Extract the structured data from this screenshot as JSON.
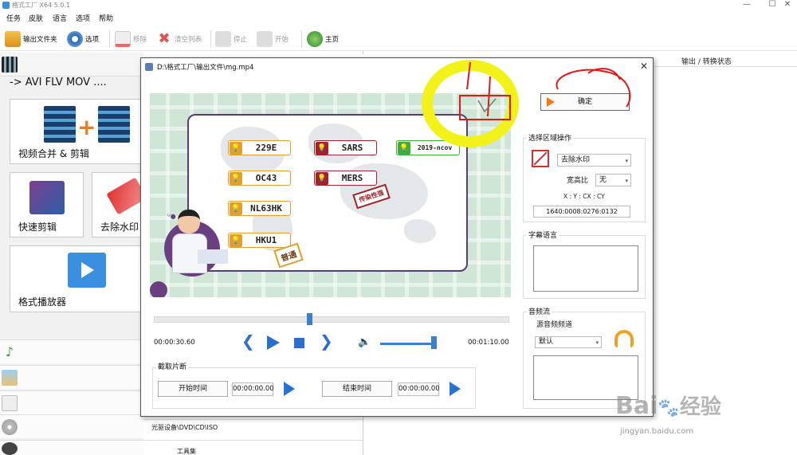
{
  "window": {
    "title": "格式工厂 X64 5.0.1",
    "min": "—",
    "max": "☐",
    "close": "✕"
  },
  "menu": [
    "任务",
    "皮肤",
    "语言",
    "选项",
    "帮助"
  ],
  "toolbar": {
    "output_folder": "输出文件夹",
    "options": "选项",
    "remove": "移除",
    "clear_list": "清空列表",
    "stop": "停止",
    "start": "开始",
    "home": "主页"
  },
  "left": {
    "formats_line": "-> AVI FLV MOV ....",
    "tiles": [
      {
        "label": "视频合并 & 剪辑",
        "icon": "film-merge-icon"
      },
      {
        "label": "快速剪辑",
        "icon": "quick-cut-icon"
      },
      {
        "label": "去除水印",
        "icon": "watermark-eraser-icon"
      },
      {
        "label": "格式播放器",
        "icon": "media-player-icon"
      }
    ],
    "rows": [
      "光驱设备\\DVD\\CD\\ISO",
      "工具集"
    ]
  },
  "list_header": {
    "output_status": "输出 / 转换状态"
  },
  "dialog": {
    "title": "D:\\格式工厂\\输出文件\\mg.mp4",
    "close": "✕",
    "confirm": "确定",
    "video": {
      "viruses": [
        "229E",
        "SARS",
        "2019-ncov",
        "OC43",
        "MERS",
        "NL63HK",
        "HKU1"
      ],
      "stamp_infectious": "传染性强",
      "stamp_common": "普通"
    },
    "time_current": "00:00:30.60",
    "time_total": "00:01:10.00",
    "seek_fraction": 0.437,
    "volume_fraction": 0.95,
    "clip": {
      "title": "截取片断",
      "start_btn": "开始时间",
      "start_val": "00:00:00.00",
      "end_btn": "结束时间",
      "end_val": "00:00:00.00"
    },
    "region": {
      "title": "选择区域操作",
      "mode": "去除水印",
      "aspect_label": "宽高比",
      "aspect_value": "无",
      "coord_label": "X : Y : CX : CY",
      "coord_value": "1640:0008:0276:0132"
    },
    "subtitle": {
      "title": "字幕语言"
    },
    "audio": {
      "title": "音频流",
      "source": "源音频频道",
      "value": "默认"
    }
  },
  "watermark": {
    "brand": "Bai",
    "brand2": "经验",
    "url": "jingyan.baidu.com"
  },
  "colors": {
    "accent": "#2a74d0",
    "annotation_yellow": "#f2f21a",
    "annotation_red": "#e01818"
  }
}
